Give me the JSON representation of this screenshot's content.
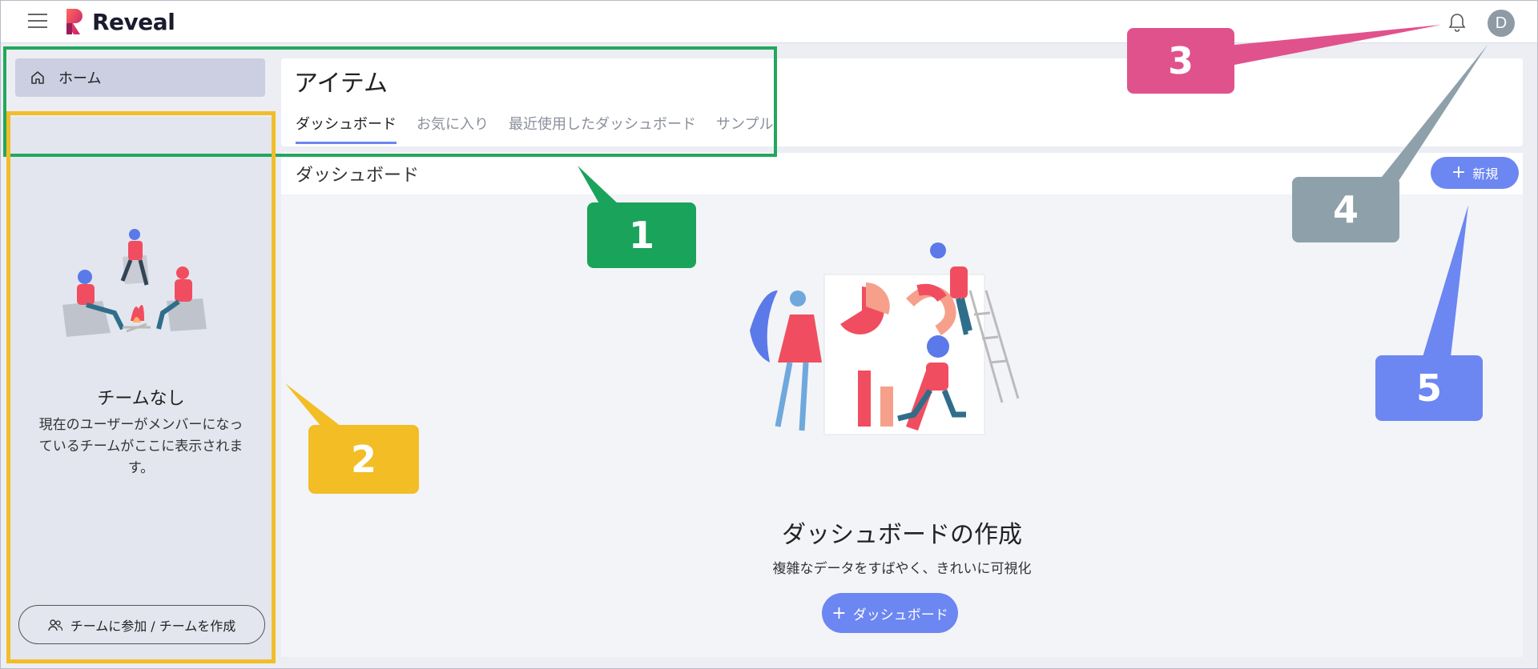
{
  "app": {
    "name": "Reveal"
  },
  "header": {
    "notifications_icon": "bell-icon",
    "avatar_initial": "D"
  },
  "sidebar": {
    "home": {
      "label": "ホーム",
      "icon": "home-icon"
    },
    "teams": {
      "title": "チームなし",
      "description": "現在のユーザーがメンバーになっているチームがここに表示されます。",
      "button_label": "チームに参加 / チームを作成",
      "button_icon": "users-icon"
    }
  },
  "main": {
    "title": "アイテム",
    "tabs": [
      {
        "label": "ダッシュボード",
        "active": true
      },
      {
        "label": "お気に入り",
        "active": false
      },
      {
        "label": "最近使用したダッシュボード",
        "active": false
      },
      {
        "label": "サンプル",
        "active": false
      }
    ],
    "section_title": "ダッシュボード",
    "new_button": "新規",
    "empty_state": {
      "title": "ダッシュボードの作成",
      "subtitle": "複雑なデータをすばやく、きれいに可視化",
      "button_label": "ダッシュボード"
    }
  },
  "annotations": [
    "1",
    "2",
    "3",
    "4",
    "5"
  ],
  "colors": {
    "accent": "#6c86f2",
    "green": "#22a85c",
    "yellow": "#f2bd2a",
    "pink": "#e0528c",
    "gray": "#8ea1aa"
  }
}
